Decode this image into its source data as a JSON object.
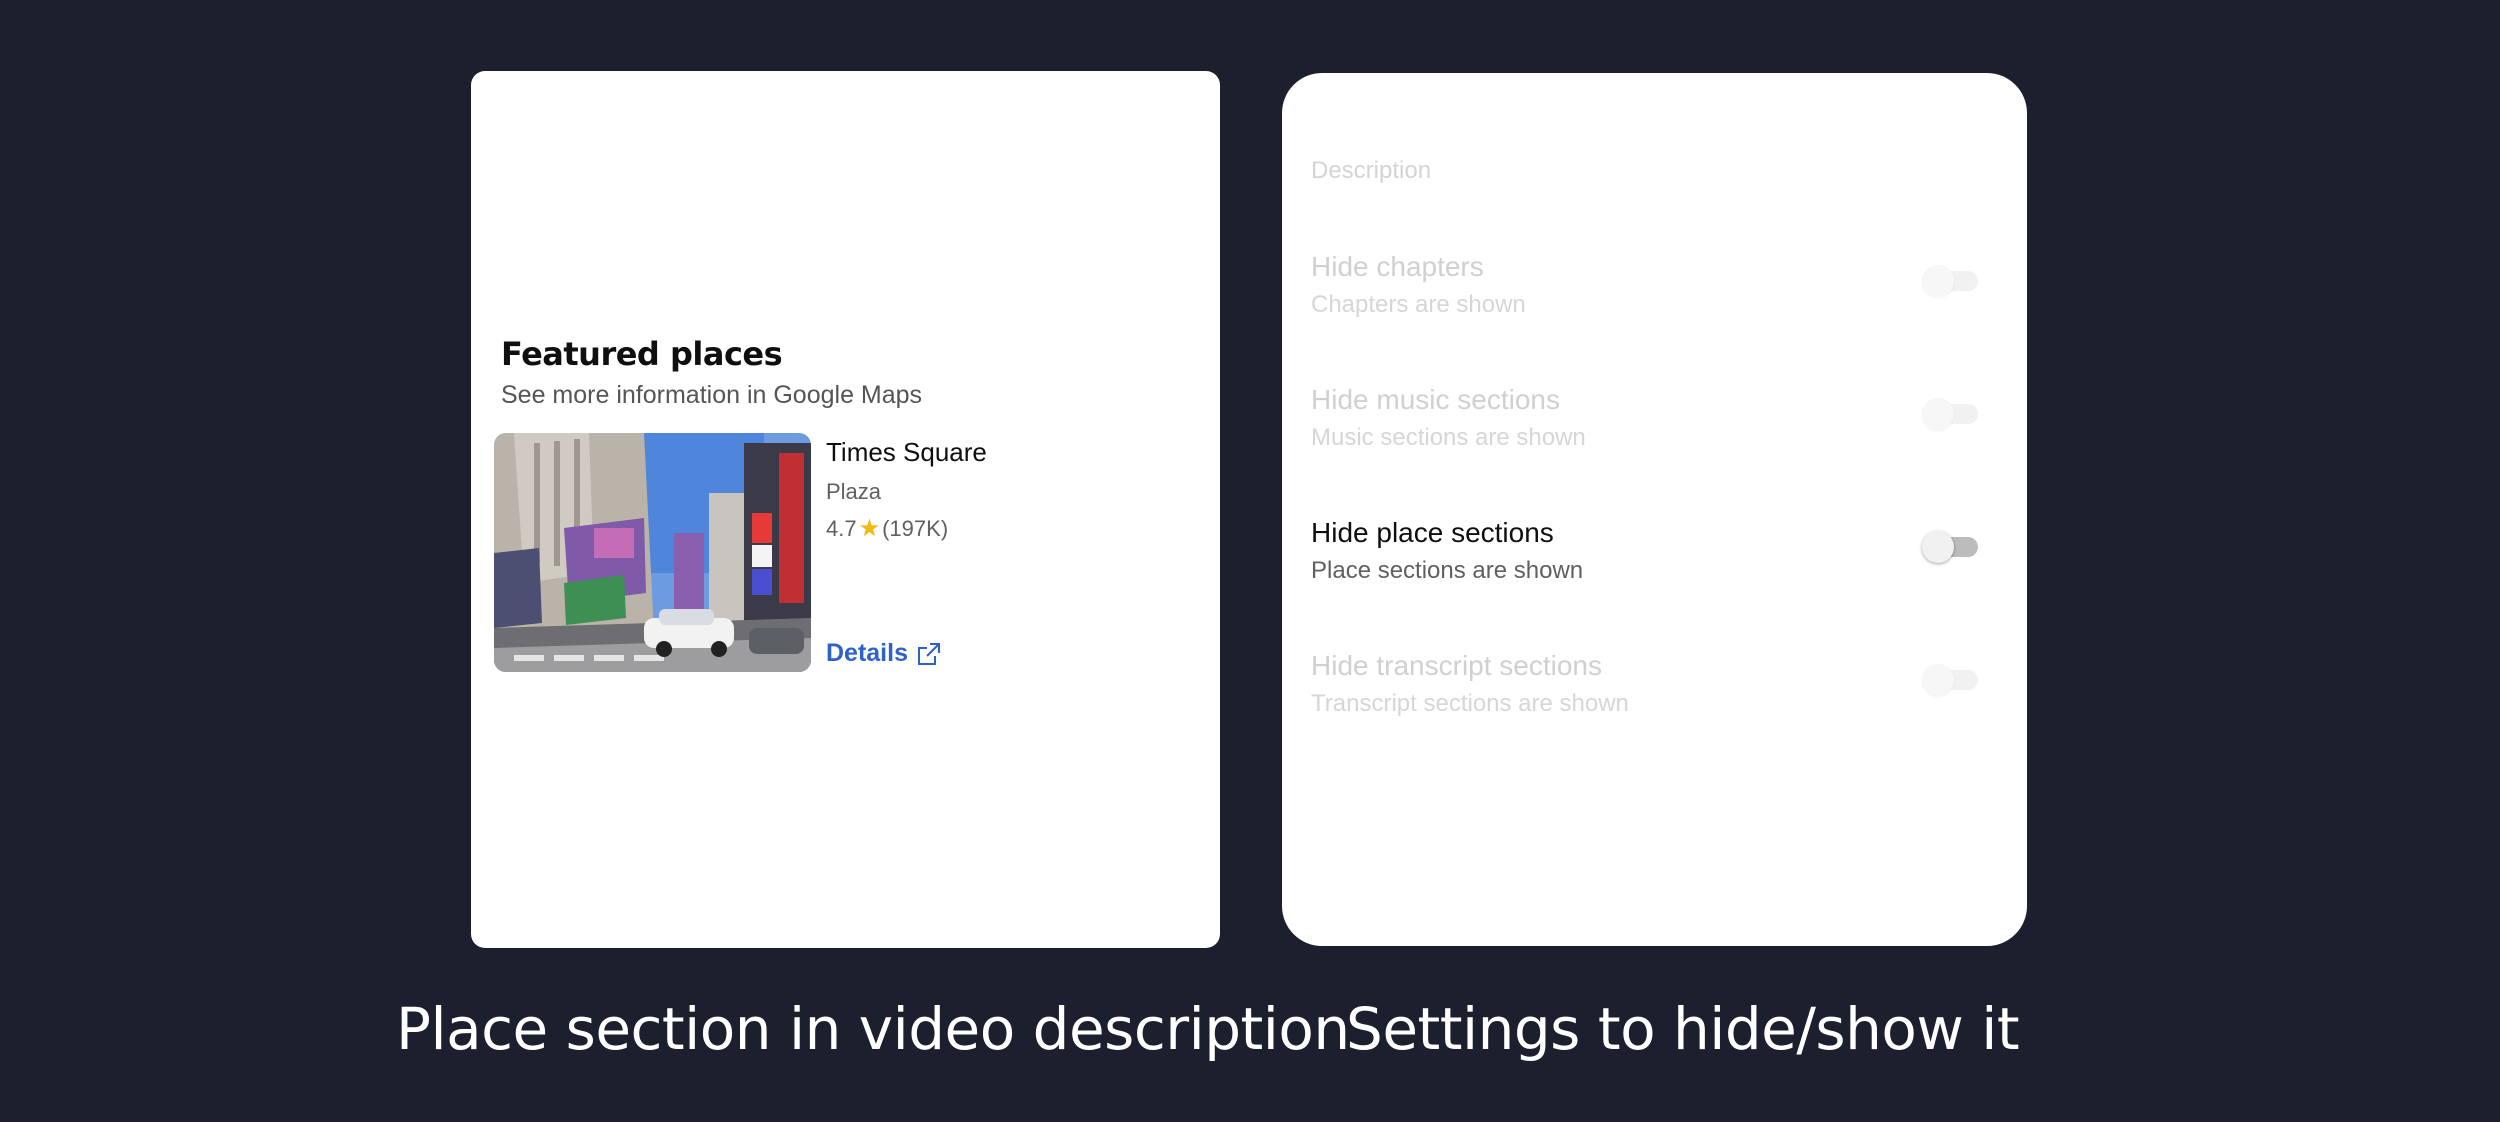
{
  "featured": {
    "title": "Featured places",
    "subtitle": "See more information in Google Maps",
    "place": {
      "name": "Times Square",
      "type": "Plaza",
      "rating": "4.7",
      "reviews": "(197K)",
      "details_label": "Details",
      "link_color": "#2f62c9",
      "star_color": "#f2b90f"
    }
  },
  "settings": {
    "heading": "Description",
    "items": [
      {
        "title": "Hide chapters",
        "desc": "Chapters are shown",
        "state": "off",
        "enabled": false
      },
      {
        "title": "Hide music sections",
        "desc": "Music sections are shown",
        "state": "off",
        "enabled": false
      },
      {
        "title": "Hide place sections",
        "desc": "Place sections are shown",
        "state": "off",
        "enabled": true
      },
      {
        "title": "Hide transcript sections",
        "desc": "Transcript sections are shown",
        "state": "off",
        "enabled": false
      }
    ]
  },
  "captions": {
    "left": "Place section in video description",
    "right": "Settings to hide/show it"
  },
  "colors": {
    "background": "#1b1f2e",
    "card": "#ffffff"
  }
}
